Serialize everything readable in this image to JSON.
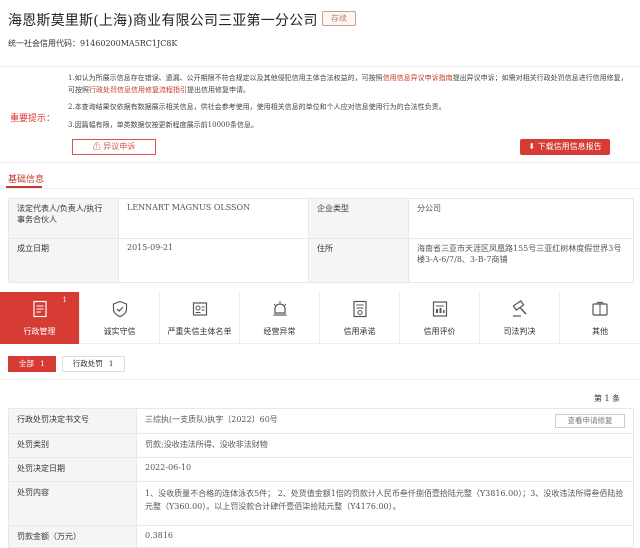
{
  "company": {
    "name": "海恩斯莫里斯(上海)商业有限公司三亚第一分公司",
    "status": "存续",
    "credit_code_label": "统一社会信用代码：",
    "credit_code": "91460200MA5RC1JC8K"
  },
  "notice": {
    "label": "重要提示：",
    "line1_a": "1.如认为所展示信息存在错误、遗漏、公开期限不符合规定以及其他侵犯信用主体合法权益的，可按照",
    "line1_link": "信用信息异议申诉指南",
    "line1_b": "提出异议申诉；如需对相关行政处罚信息进行信用修复，可按照",
    "line1_link2": "行政处罚信息信用修复流程指引",
    "line1_c": "提出信用修复申请。",
    "line2": "2.本查询结果仅依据有数据展示相关信息，供社会参考使用，使用相关信息的单位和个人应对信息使用行为的合法性负责。",
    "line3": "3.因篇幅有限，单类数据仅按更新程度展示前10000条信息。",
    "objection_button": "异议申诉",
    "download_button": "下载信用信息报告"
  },
  "basic_info": {
    "section_title": "基础信息",
    "rows": [
      {
        "label1": "法定代表人/负责人/执行事务合伙人",
        "value1": "LENNART MAGNUS OLSSON",
        "label2": "企业类型",
        "value2": "分公司"
      },
      {
        "label1": "成立日期",
        "value1": "2015-09-21",
        "label2": "住所",
        "value2": "海南省三亚市天涯区凤凰路155号三亚红树林度假世界3号楼3-A-6/7/8、3-B-7商铺"
      }
    ]
  },
  "tabs": [
    {
      "name": "tab-admin-management",
      "label": "行政管理",
      "count": "1",
      "icon": "document-icon",
      "active": true
    },
    {
      "name": "tab-honesty",
      "label": "诚实守信",
      "count": "",
      "icon": "shield-icon",
      "active": false
    },
    {
      "name": "tab-blacklist",
      "label": "严重失信主体名单",
      "count": "",
      "icon": "blacklist-icon",
      "active": false
    },
    {
      "name": "tab-abnormal",
      "label": "经营异常",
      "count": "",
      "icon": "alert-icon",
      "active": false
    },
    {
      "name": "tab-credit-promise",
      "label": "信用承诺",
      "count": "",
      "icon": "promise-icon",
      "active": false
    },
    {
      "name": "tab-credit-rating",
      "label": "信用评价",
      "count": "",
      "icon": "rating-icon",
      "active": false
    },
    {
      "name": "tab-judicial",
      "label": "司法判决",
      "count": "",
      "icon": "gavel-icon",
      "active": false
    },
    {
      "name": "tab-other",
      "label": "其他",
      "count": "",
      "icon": "other-icon",
      "active": false
    }
  ],
  "filters": [
    {
      "label": "全部",
      "count": "1",
      "active": true
    },
    {
      "label": "行政处罚",
      "count": "1",
      "active": false
    }
  ],
  "record_no": "第 1 条",
  "record": {
    "view_repair_button": "查看申请修复",
    "rows": [
      {
        "label": "行政处罚决定书文号",
        "value": "三综执(一支质队)执字〔2022〕60号"
      },
      {
        "label": "处罚类别",
        "value": "罚款;没收违法所得、没收非法财物"
      },
      {
        "label": "处罚决定日期",
        "value": "2022-06-10"
      },
      {
        "label": "处罚内容",
        "value": "1、没收质量不合格的连体泳衣5件； 2、处货值金额1倍的罚款计人民币叁仟捌佰壹拾陆元整（Y3816.00）；3、没收违法所得叁佰陆拾元整（Y360.00）。以上罚没款合计肆仟壹佰柒拾陆元整（Y4176.00）。"
      },
      {
        "label": "罚款金额（万元）",
        "value": "0.3816"
      }
    ]
  },
  "colors": {
    "accent": "#d63b34",
    "label_bg": "#f5f5f5"
  }
}
